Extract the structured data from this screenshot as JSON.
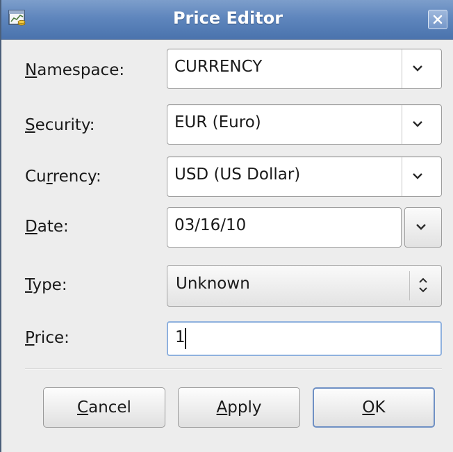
{
  "window": {
    "title": "Price Editor",
    "accent_color": "#5f86bd",
    "app_icon": "price-editor-app-icon",
    "close_icon": "close-icon"
  },
  "form": {
    "namespace": {
      "label_key": "N",
      "label_rest": "amespace:",
      "value": "CURRENCY"
    },
    "security": {
      "label_key": "S",
      "label_rest": "ecurity:",
      "value": "EUR (Euro)"
    },
    "currency": {
      "label_pre": "Cu",
      "label_key": "r",
      "label_rest": "rency:",
      "value": "USD (US Dollar)"
    },
    "date": {
      "label_key": "D",
      "label_rest": "ate:",
      "value": "03/16/10"
    },
    "type": {
      "label_key": "T",
      "label_rest": "ype:",
      "value": "Unknown"
    },
    "price": {
      "label_key": "P",
      "label_rest": "rice:",
      "value": "1"
    }
  },
  "buttons": {
    "cancel": {
      "key": "C",
      "rest": "ancel"
    },
    "apply": {
      "key": "A",
      "rest": "pply"
    },
    "ok": {
      "key": "O",
      "rest": "K"
    }
  }
}
